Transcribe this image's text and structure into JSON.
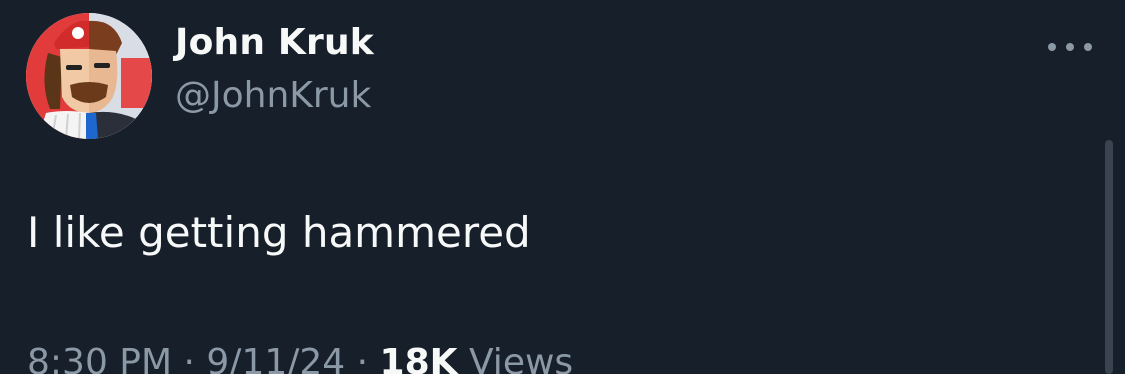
{
  "tweet": {
    "author": {
      "display_name": "John Kruk",
      "handle": "@JohnKruk",
      "avatar_icon": "cartoon-avatar"
    },
    "more_icon": "more-dots-icon",
    "text": "I like getting hammered",
    "meta": {
      "time": "8:30 PM",
      "separator": " · ",
      "date": "9/11/24",
      "views_count": "18K",
      "views_label": " Views"
    }
  },
  "colors": {
    "background": "#161f2a",
    "primary_text": "#f7f9f9",
    "secondary_text": "#8b98a5"
  }
}
